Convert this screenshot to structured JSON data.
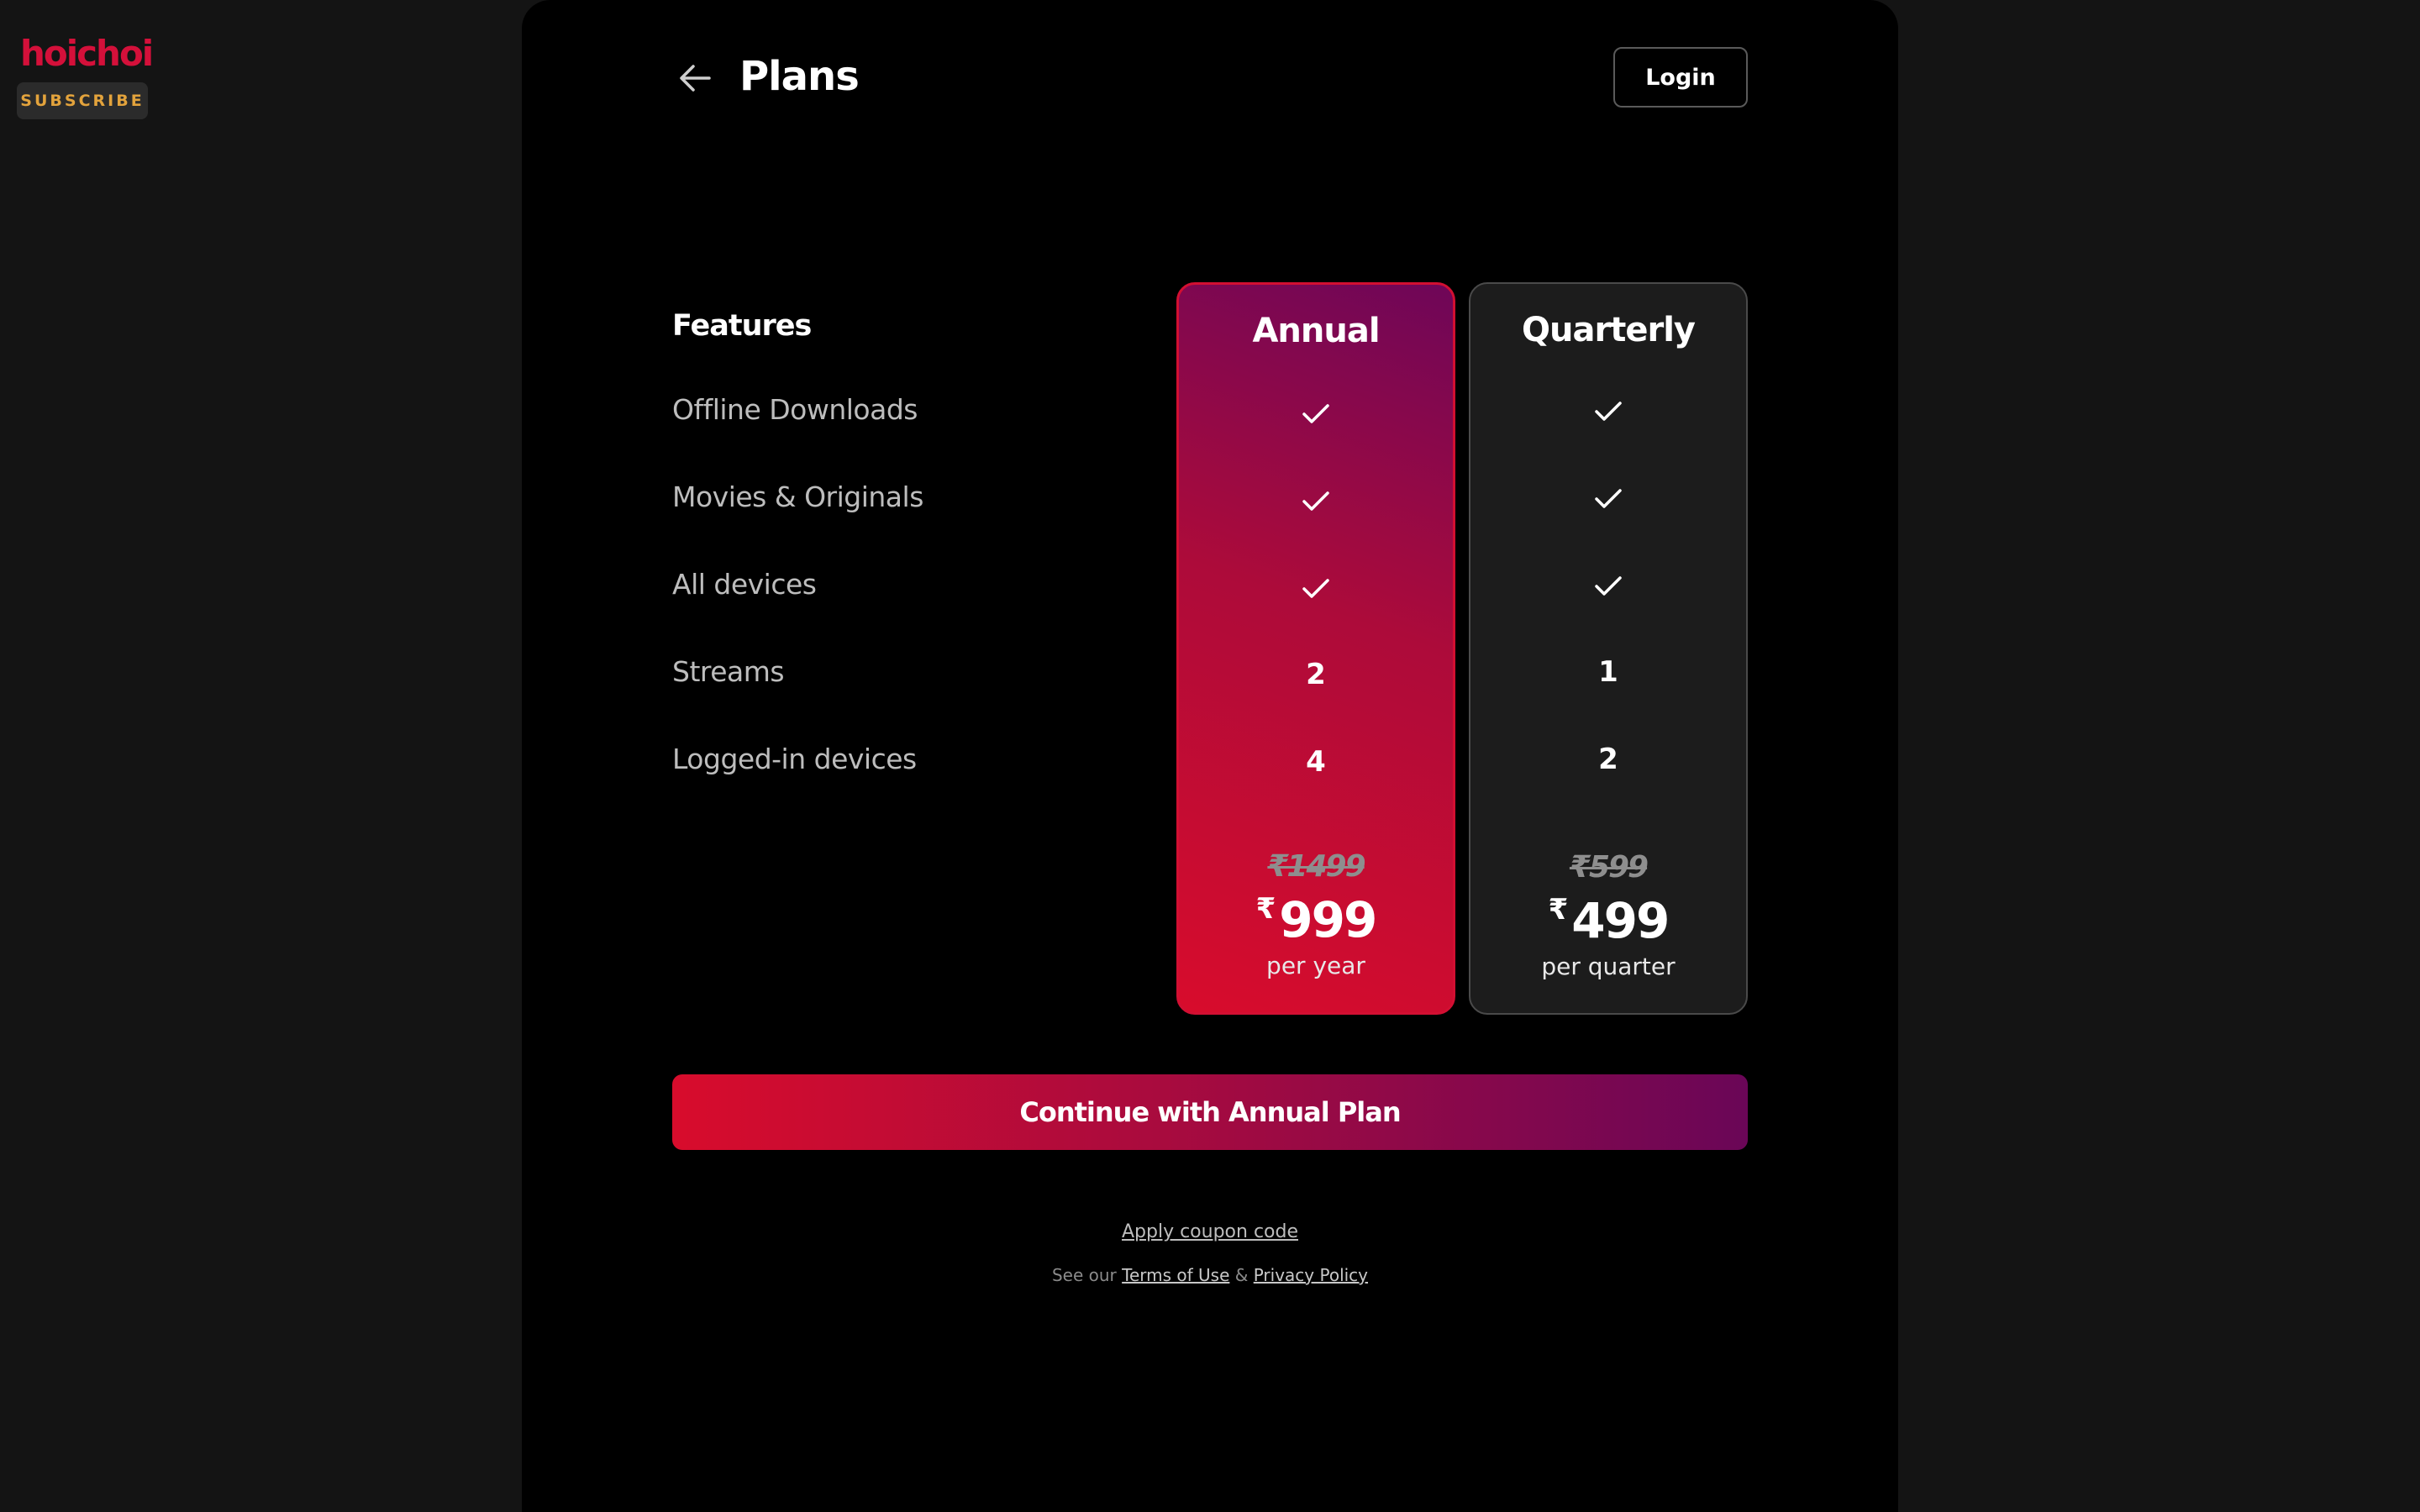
{
  "brand": {
    "logo_text": "hoichoi",
    "subscribe_label": "SUBSCRIBE",
    "logo_color": "#d4103a",
    "subscribe_color": "#e3a33c"
  },
  "header": {
    "back_icon": "arrow-left-icon",
    "title": "Plans",
    "login_label": "Login"
  },
  "features": {
    "heading": "Features",
    "items": [
      "Offline Downloads",
      "Movies & Originals",
      "All devices",
      "Streams",
      "Logged-in devices"
    ]
  },
  "plans": [
    {
      "name": "Annual",
      "selected": true,
      "values": [
        "check",
        "check",
        "check",
        "2",
        "4"
      ],
      "old_price": "₹1499",
      "currency": "₹",
      "price": "999",
      "period": "per year"
    },
    {
      "name": "Quarterly",
      "selected": false,
      "values": [
        "check",
        "check",
        "check",
        "1",
        "2"
      ],
      "old_price": "₹599",
      "currency": "₹",
      "price": "499",
      "period": "per quarter"
    }
  ],
  "cta": {
    "label": "Continue with Annual Plan"
  },
  "footer": {
    "coupon_label": "Apply coupon code",
    "legal_prefix": "See our",
    "terms_label": "Terms of Use",
    "amp": "&",
    "privacy_label": "Privacy Policy"
  },
  "colors": {
    "accent_red": "#d80c2c",
    "accent_purple": "#6a0657",
    "panel_bg": "#000000",
    "page_bg": "#141414"
  }
}
